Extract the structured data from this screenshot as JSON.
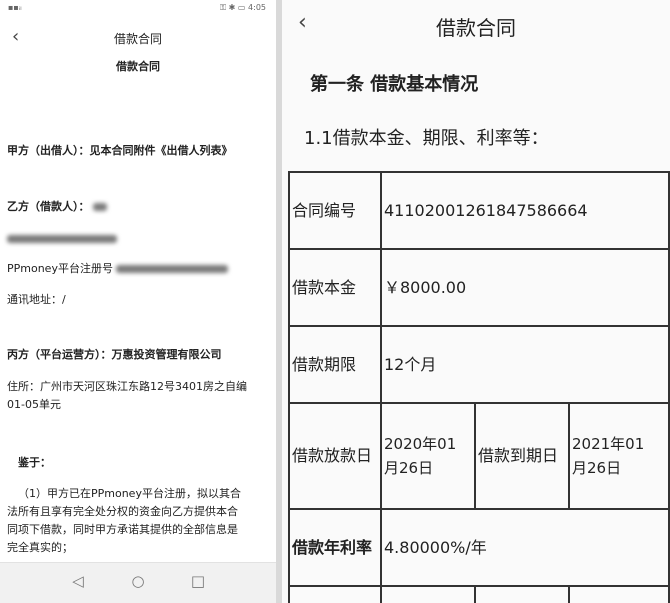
{
  "left_phone": {
    "status_right": "4:05",
    "nav_title": "借款合同",
    "document_title": "借款合同",
    "party_a": "甲方（出借人）：见本合同附件《出借人列表》",
    "party_b_label": "乙方（借款人）：",
    "pp_reg_label": "PPmoney平台注册号",
    "address_label": "通讯地址：/",
    "party_c": "丙方（平台运营方）：万惠投资管理有限公司",
    "residence_line1": "住所：广州市天河区珠江东路12号3401房之自编",
    "residence_line2": "01-05单元",
    "whereas_label": "鉴于：",
    "clause1_line1": "（1）甲方已在PPmoney平台注册，拟以其合",
    "clause1_line2": "法所有且享有完全处分权的资金向乙方提供本合",
    "clause1_line3": "同项下借款，同时甲方承诺其提供的全部信息是",
    "clause1_line4": "完全真实的；",
    "nav_buttons": [
      "◁",
      "○",
      "□"
    ]
  },
  "right_phone": {
    "nav_title": "借款合同",
    "article_title": "第一条 借款基本情况",
    "section_title": "1.1借款本金、期限、利率等：",
    "table": {
      "contract_no_label": "合同编号",
      "contract_no": "41102001261847586664",
      "principal_label": "借款本金",
      "principal": "￥8000.00",
      "term_label": "借款期限",
      "term": "12个月",
      "issue_date_label": "借款放款日",
      "issue_date_line1": "2020年01",
      "issue_date_line2": "月26日",
      "due_date_label": "借款到期日",
      "due_date_line1": "2021年01",
      "due_date_line2": "月26日",
      "rate_label": "借款年利率",
      "rate": "4.80000%/年"
    }
  }
}
